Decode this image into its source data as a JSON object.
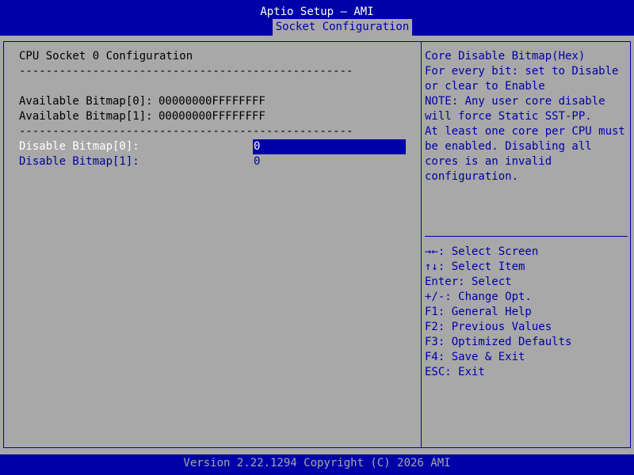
{
  "header": {
    "title": "Aptio Setup – AMI",
    "active_tab": "Socket Configuration"
  },
  "main": {
    "section_title": "CPU Socket 0 Configuration",
    "separator": "--------------------------------------------------",
    "available": [
      {
        "label": "Available Bitmap[0]:",
        "value": "00000000FFFFFFFF"
      },
      {
        "label": "Available Bitmap[1]:",
        "value": "00000000FFFFFFFF"
      }
    ],
    "options": [
      {
        "label": "Disable Bitmap[0]:",
        "value": "0",
        "selected": true
      },
      {
        "label": "Disable Bitmap[1]:",
        "value": "0",
        "selected": false
      }
    ]
  },
  "help": {
    "lines": [
      "Core Disable Bitmap(Hex)",
      "For every bit: set to Disable",
      "or clear to Enable",
      "NOTE: Any user core disable",
      "will force Static SST-PP.",
      "At least one core per CPU must",
      "be enabled. Disabling all",
      "cores is an invalid",
      "configuration."
    ]
  },
  "keys": [
    "→←: Select Screen",
    "↑↓: Select Item",
    "Enter: Select",
    "+/-: Change Opt.",
    "F1: General Help",
    "F2: Previous Values",
    "F3: Optimized Defaults",
    "F4: Save & Exit",
    "ESC: Exit"
  ],
  "footer": {
    "text": "Version 2.22.1294 Copyright (C) 2026 AMI"
  },
  "colors": {
    "background": "#a8a8a8",
    "accent": "#0000a8",
    "highlight_text": "#ffffff"
  }
}
